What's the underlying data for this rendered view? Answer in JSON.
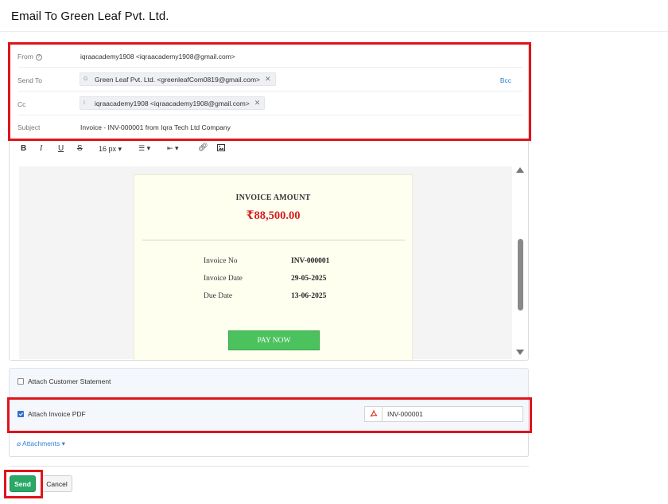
{
  "page": {
    "title": "Email To Green Leaf Pvt. Ltd."
  },
  "header": {
    "from_label": "From",
    "from_value": "iqraacademy1908 <iqraacademy1908@gmail.com>",
    "sendto_label": "Send To",
    "sendto_chip": {
      "initial": "G",
      "text": "Green Leaf Pvt. Ltd. <greenleafCom0819@gmail.com>"
    },
    "bcc_label": "Bcc",
    "cc_label": "Cc",
    "cc_chip": {
      "initial": "I",
      "text": "iqraacademy1908 <iqraacademy1908@gmail.com>"
    },
    "subject_label": "Subject",
    "subject_value": "Invoice - INV-000001 from Iqra Tech Ltd Company"
  },
  "toolbar": {
    "bold": "B",
    "italic": "I",
    "underline": "U",
    "strike": "S",
    "font_size": "16 px"
  },
  "invoice": {
    "heading": "INVOICE AMOUNT",
    "amount": "₹88,500.00",
    "rows": [
      {
        "label": "Invoice No",
        "value": "INV-000001"
      },
      {
        "label": "Invoice Date",
        "value": "29-05-2025"
      },
      {
        "label": "Due Date",
        "value": "13-06-2025"
      }
    ],
    "pay_button": "PAY NOW"
  },
  "options": {
    "attach_statement": {
      "label": "Attach Customer Statement",
      "checked": false
    },
    "attach_pdf": {
      "label": "Attach Invoice PDF",
      "checked": true,
      "file_name": "INV-000001"
    }
  },
  "attachments_label": "Attachments",
  "footer": {
    "send": "Send",
    "cancel": "Cancel"
  },
  "colors": {
    "highlight": "#e0141b",
    "send": "#2aa866",
    "pay_now": "#4cc25e",
    "amount": "#d21e1e",
    "link": "#2f7fd4"
  }
}
